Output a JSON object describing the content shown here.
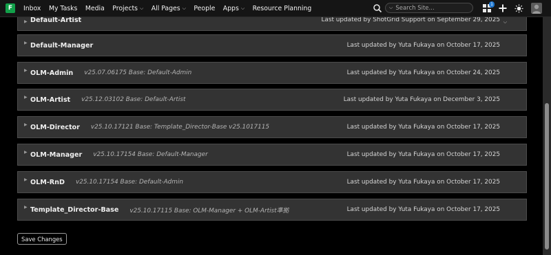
{
  "topbar": {
    "logo_letter": "F",
    "nav": [
      {
        "label": "Inbox",
        "dropdown": false
      },
      {
        "label": "My Tasks",
        "dropdown": false
      },
      {
        "label": "Media",
        "dropdown": false
      },
      {
        "label": "Projects",
        "dropdown": true
      },
      {
        "label": "All Pages",
        "dropdown": true
      },
      {
        "label": "People",
        "dropdown": false
      },
      {
        "label": "Apps",
        "dropdown": true
      },
      {
        "label": "Resource Planning",
        "dropdown": false
      }
    ],
    "search_placeholder": "Search Site...",
    "notification_badge": "1",
    "icons": [
      "search-icon",
      "apps-grid-icon",
      "plus-icon",
      "settings-sun-icon",
      "avatar"
    ]
  },
  "rows": [
    {
      "name": "Default-Artist",
      "desc": "",
      "updated": "Last updated by ShotGrid Support on September 29, 2025",
      "partially_hidden": true
    },
    {
      "name": "Default-Manager",
      "desc": "",
      "updated": "Last updated by Yuta Fukaya on October 17, 2025"
    },
    {
      "name": "OLM-Admin",
      "desc": "v25.07.06175 Base: Default-Admin",
      "updated": "Last updated by Yuta Fukaya on October 24, 2025"
    },
    {
      "name": "OLM-Artist",
      "desc": "v25.12.03102 Base: Default-Artist",
      "updated": "Last updated by Yuta Fukaya on December 3, 2025"
    },
    {
      "name": "OLM-Director",
      "desc": "v25.10.17121 Base: Template_Director-Base v25.1017115",
      "updated": "Last updated by Yuta Fukaya on October 17, 2025"
    },
    {
      "name": "OLM-Manager",
      "desc": "v25.10.17154 Base: Default-Manager",
      "updated": "Last updated by Yuta Fukaya on October 17, 2025"
    },
    {
      "name": "OLM-RnD",
      "desc": "v25.10.17154 Base: Default-Admin",
      "updated": "Last updated by Yuta Fukaya on October 17, 2025"
    },
    {
      "name": "Template_Director-Base",
      "desc": "v25.10.17115 Base: OLM-Manager + OLM-Artist準拠",
      "updated": "Last updated by Yuta Fukaya on October 17, 2025"
    }
  ],
  "save_button": "Save Changes",
  "colors": {
    "accent_logo": "#12a14a",
    "row_bg": "#333333",
    "badge": "#1f78d1"
  }
}
